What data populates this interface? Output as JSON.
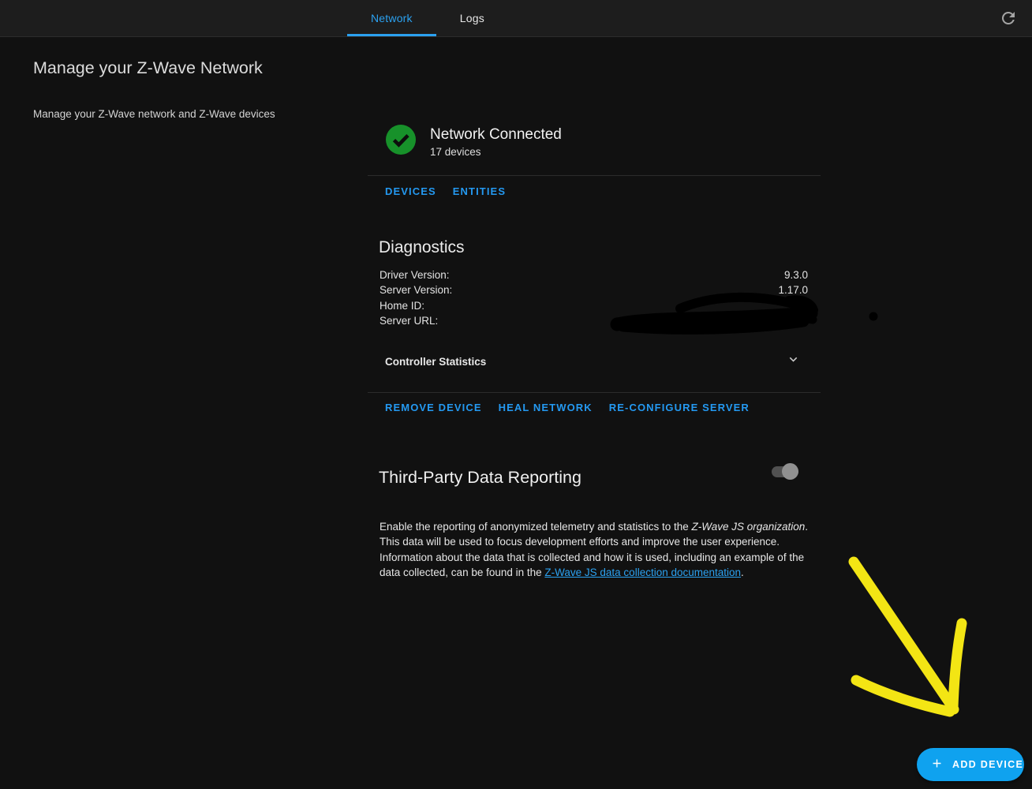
{
  "topbar": {
    "tabs": [
      {
        "label": "Network",
        "active": true
      },
      {
        "label": "Logs",
        "active": false
      }
    ]
  },
  "page": {
    "title": "Manage your Z-Wave Network",
    "subtitle": "Manage your Z-Wave network and Z-Wave devices"
  },
  "status": {
    "title": "Network Connected",
    "subtitle": "17 devices"
  },
  "status_actions": {
    "devices": "DEVICES",
    "entities": "ENTITIES"
  },
  "diagnostics": {
    "title": "Diagnostics",
    "rows": [
      {
        "label": "Driver Version:",
        "value": "9.3.0",
        "redacted": false
      },
      {
        "label": "Server Version:",
        "value": "1.17.0",
        "redacted": false
      },
      {
        "label": "Home ID:",
        "value": "",
        "redacted": true
      },
      {
        "label": "Server URL:",
        "value": "",
        "redacted": true
      }
    ],
    "controller_statistics_label": "Controller Statistics"
  },
  "network_actions": {
    "remove_device": "REMOVE DEVICE",
    "heal_network": "HEAL NETWORK",
    "reconfigure_server": "RE-CONFIGURE SERVER"
  },
  "reporting": {
    "title": "Third-Party Data Reporting",
    "toggle_state": "on",
    "description": {
      "part1": "Enable the reporting of anonymized telemetry and statistics to the ",
      "italic": "Z-Wave JS organization",
      "part2": ". This data will be used to focus development efforts and improve the user experience. Information about the data that is collected and how it is used, including an example of the data collected, can be found in the ",
      "link": "Z-Wave JS data collection documentation",
      "part3": "."
    }
  },
  "fab": {
    "label": "ADD DEVICE"
  },
  "icons": {
    "refresh": "refresh-icon",
    "status": "check-circle-icon",
    "expander": "chevron-down-icon",
    "fab": "plus-icon"
  },
  "colors": {
    "accent_blue": "#2ba1f0",
    "button_blue": "#2499f1",
    "fab_blue": "#0fa2ef",
    "success_green": "#17912a",
    "arrow_yellow": "#f3e514",
    "topbar_bg": "#1d1d1d",
    "page_bg": "#111111"
  }
}
